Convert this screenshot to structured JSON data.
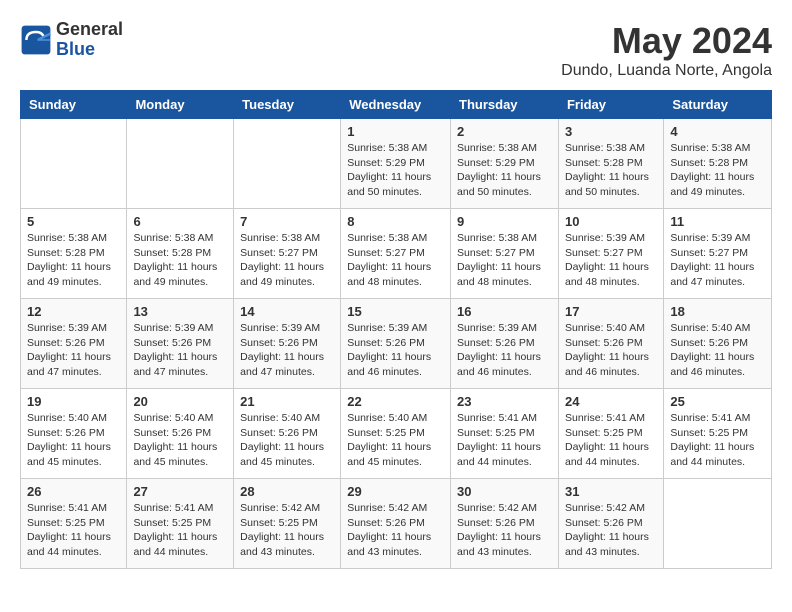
{
  "logo": {
    "general": "General",
    "blue": "Blue"
  },
  "title": "May 2024",
  "location": "Dundo, Luanda Norte, Angola",
  "days_of_week": [
    "Sunday",
    "Monday",
    "Tuesday",
    "Wednesday",
    "Thursday",
    "Friday",
    "Saturday"
  ],
  "weeks": [
    [
      {
        "day": "",
        "info": ""
      },
      {
        "day": "",
        "info": ""
      },
      {
        "day": "",
        "info": ""
      },
      {
        "day": "1",
        "info": "Sunrise: 5:38 AM\nSunset: 5:29 PM\nDaylight: 11 hours\nand 50 minutes."
      },
      {
        "day": "2",
        "info": "Sunrise: 5:38 AM\nSunset: 5:29 PM\nDaylight: 11 hours\nand 50 minutes."
      },
      {
        "day": "3",
        "info": "Sunrise: 5:38 AM\nSunset: 5:28 PM\nDaylight: 11 hours\nand 50 minutes."
      },
      {
        "day": "4",
        "info": "Sunrise: 5:38 AM\nSunset: 5:28 PM\nDaylight: 11 hours\nand 49 minutes."
      }
    ],
    [
      {
        "day": "5",
        "info": "Sunrise: 5:38 AM\nSunset: 5:28 PM\nDaylight: 11 hours\nand 49 minutes."
      },
      {
        "day": "6",
        "info": "Sunrise: 5:38 AM\nSunset: 5:28 PM\nDaylight: 11 hours\nand 49 minutes."
      },
      {
        "day": "7",
        "info": "Sunrise: 5:38 AM\nSunset: 5:27 PM\nDaylight: 11 hours\nand 49 minutes."
      },
      {
        "day": "8",
        "info": "Sunrise: 5:38 AM\nSunset: 5:27 PM\nDaylight: 11 hours\nand 48 minutes."
      },
      {
        "day": "9",
        "info": "Sunrise: 5:38 AM\nSunset: 5:27 PM\nDaylight: 11 hours\nand 48 minutes."
      },
      {
        "day": "10",
        "info": "Sunrise: 5:39 AM\nSunset: 5:27 PM\nDaylight: 11 hours\nand 48 minutes."
      },
      {
        "day": "11",
        "info": "Sunrise: 5:39 AM\nSunset: 5:27 PM\nDaylight: 11 hours\nand 47 minutes."
      }
    ],
    [
      {
        "day": "12",
        "info": "Sunrise: 5:39 AM\nSunset: 5:26 PM\nDaylight: 11 hours\nand 47 minutes."
      },
      {
        "day": "13",
        "info": "Sunrise: 5:39 AM\nSunset: 5:26 PM\nDaylight: 11 hours\nand 47 minutes."
      },
      {
        "day": "14",
        "info": "Sunrise: 5:39 AM\nSunset: 5:26 PM\nDaylight: 11 hours\nand 47 minutes."
      },
      {
        "day": "15",
        "info": "Sunrise: 5:39 AM\nSunset: 5:26 PM\nDaylight: 11 hours\nand 46 minutes."
      },
      {
        "day": "16",
        "info": "Sunrise: 5:39 AM\nSunset: 5:26 PM\nDaylight: 11 hours\nand 46 minutes."
      },
      {
        "day": "17",
        "info": "Sunrise: 5:40 AM\nSunset: 5:26 PM\nDaylight: 11 hours\nand 46 minutes."
      },
      {
        "day": "18",
        "info": "Sunrise: 5:40 AM\nSunset: 5:26 PM\nDaylight: 11 hours\nand 46 minutes."
      }
    ],
    [
      {
        "day": "19",
        "info": "Sunrise: 5:40 AM\nSunset: 5:26 PM\nDaylight: 11 hours\nand 45 minutes."
      },
      {
        "day": "20",
        "info": "Sunrise: 5:40 AM\nSunset: 5:26 PM\nDaylight: 11 hours\nand 45 minutes."
      },
      {
        "day": "21",
        "info": "Sunrise: 5:40 AM\nSunset: 5:26 PM\nDaylight: 11 hours\nand 45 minutes."
      },
      {
        "day": "22",
        "info": "Sunrise: 5:40 AM\nSunset: 5:25 PM\nDaylight: 11 hours\nand 45 minutes."
      },
      {
        "day": "23",
        "info": "Sunrise: 5:41 AM\nSunset: 5:25 PM\nDaylight: 11 hours\nand 44 minutes."
      },
      {
        "day": "24",
        "info": "Sunrise: 5:41 AM\nSunset: 5:25 PM\nDaylight: 11 hours\nand 44 minutes."
      },
      {
        "day": "25",
        "info": "Sunrise: 5:41 AM\nSunset: 5:25 PM\nDaylight: 11 hours\nand 44 minutes."
      }
    ],
    [
      {
        "day": "26",
        "info": "Sunrise: 5:41 AM\nSunset: 5:25 PM\nDaylight: 11 hours\nand 44 minutes."
      },
      {
        "day": "27",
        "info": "Sunrise: 5:41 AM\nSunset: 5:25 PM\nDaylight: 11 hours\nand 44 minutes."
      },
      {
        "day": "28",
        "info": "Sunrise: 5:42 AM\nSunset: 5:25 PM\nDaylight: 11 hours\nand 43 minutes."
      },
      {
        "day": "29",
        "info": "Sunrise: 5:42 AM\nSunset: 5:26 PM\nDaylight: 11 hours\nand 43 minutes."
      },
      {
        "day": "30",
        "info": "Sunrise: 5:42 AM\nSunset: 5:26 PM\nDaylight: 11 hours\nand 43 minutes."
      },
      {
        "day": "31",
        "info": "Sunrise: 5:42 AM\nSunset: 5:26 PM\nDaylight: 11 hours\nand 43 minutes."
      },
      {
        "day": "",
        "info": ""
      }
    ]
  ]
}
